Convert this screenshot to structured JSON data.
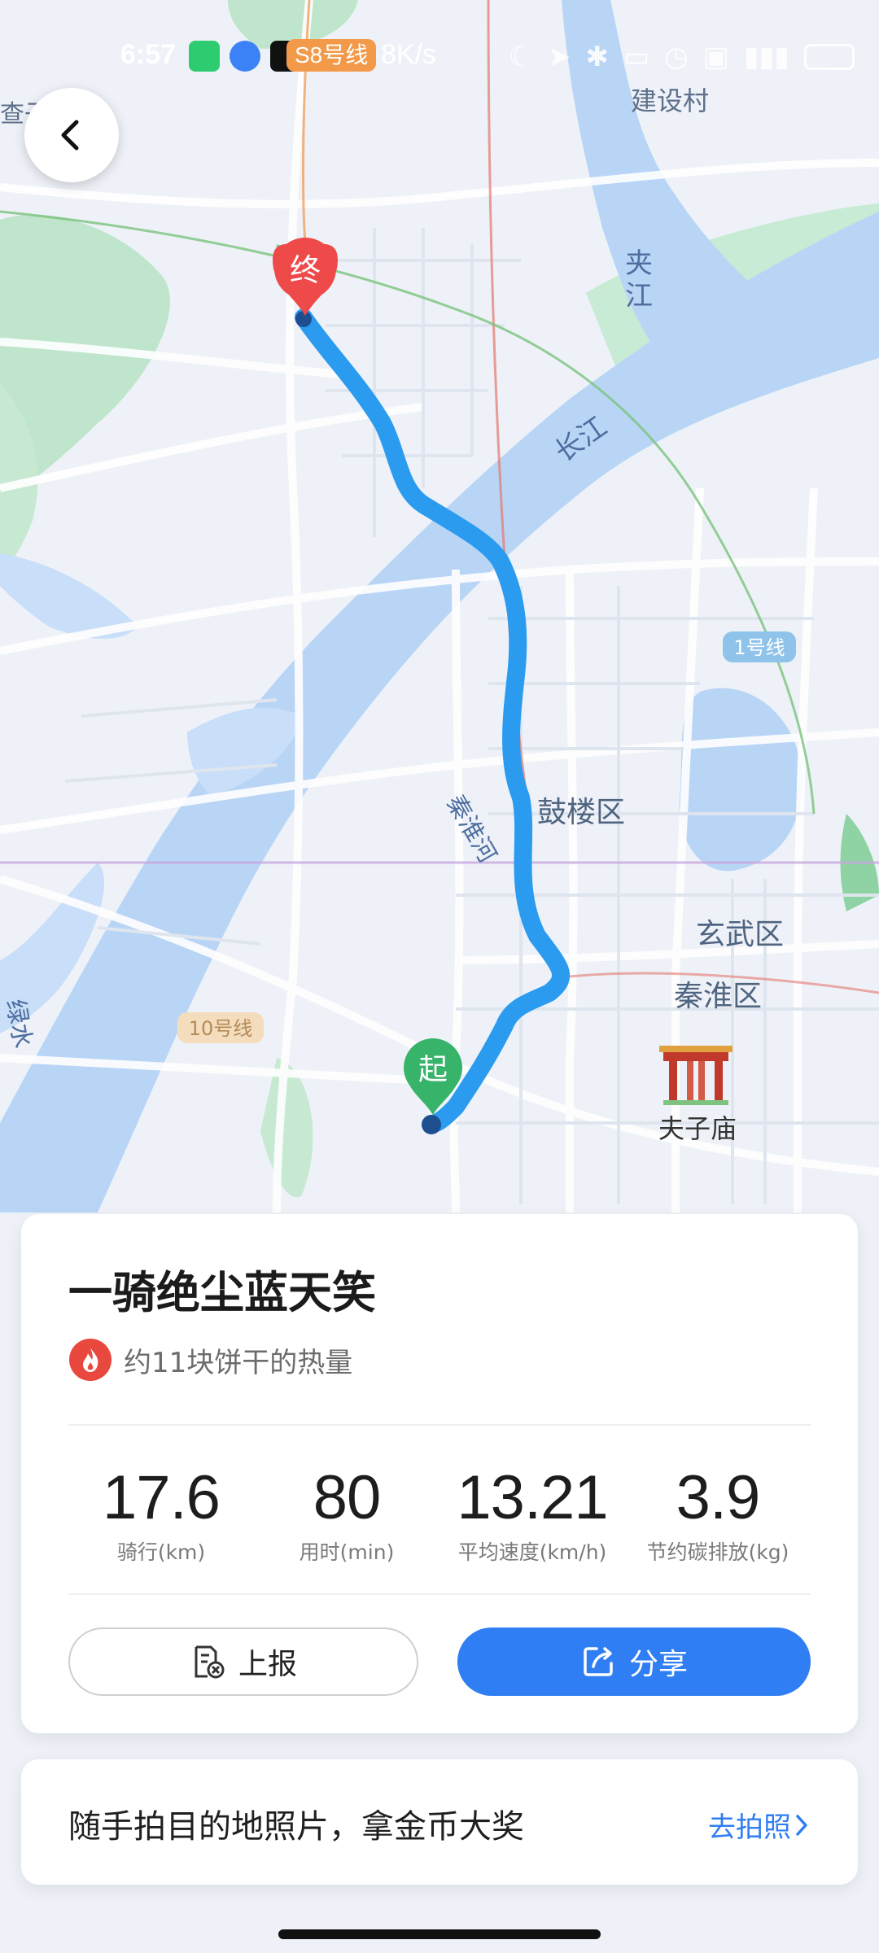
{
  "status_bar": {
    "time": "6:57",
    "app_badge": "S8号线",
    "net_speed": "8K/s"
  },
  "map": {
    "labels": {
      "jianshecun": "建设村",
      "jiajiang": "夹\n江",
      "changjiang": "长江",
      "line1": "1号线",
      "line10": "10号线",
      "qinhuaihe": "秦淮河",
      "gulou": "鼓楼区",
      "xuanwu": "玄武区",
      "qinhuai": "秦淮区",
      "fuzimiao": "夫子庙",
      "partial_topleft": "查子",
      "partial_left": "绿水"
    },
    "start_marker": "起",
    "end_marker": "终",
    "route_color": "#2b9bf0",
    "start_color": "#38b36a",
    "end_color": "#ef4a4a"
  },
  "summary": {
    "title": "一骑绝尘蓝天笑",
    "calorie_text": "约11块饼干的热量",
    "stats": [
      {
        "value": "17.6",
        "label": "骑行(km)"
      },
      {
        "value": "80",
        "label": "用时(min)"
      },
      {
        "value": "13.21",
        "label": "平均速度(km/h)"
      },
      {
        "value": "3.9",
        "label": "节约碳排放(kg)"
      }
    ],
    "report_label": "上报",
    "share_label": "分享"
  },
  "promo": {
    "text": "随手拍目的地照片，拿金币大奖",
    "link_label": "去拍照"
  },
  "colors": {
    "accent": "#2f7ef3",
    "water": "#b9d5f6",
    "green": "#b7e3c4"
  }
}
